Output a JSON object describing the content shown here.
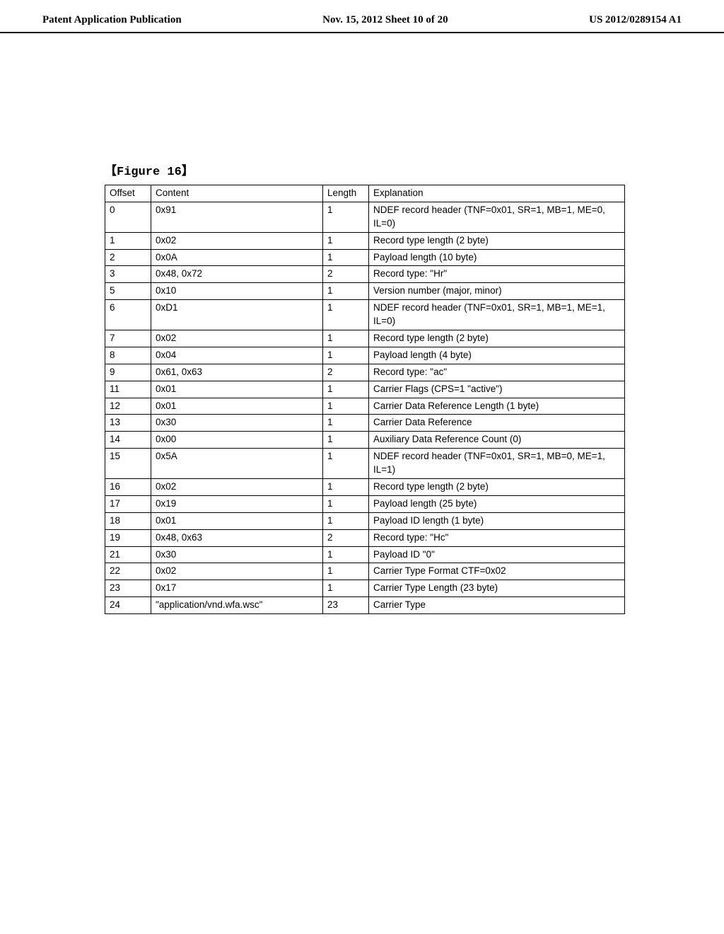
{
  "header": {
    "left": "Patent Application Publication",
    "center": "Nov. 15, 2012  Sheet 10 of 20",
    "right": "US 2012/0289154 A1"
  },
  "figure_title": "【Figure 16】",
  "columns": [
    "Offset",
    "Content",
    "Length",
    "Explanation"
  ],
  "rows": [
    {
      "offset": "0",
      "content": "0x91",
      "length": "1",
      "explanation": "NDEF record header (TNF=0x01, SR=1, MB=1, ME=0, IL=0)"
    },
    {
      "offset": "1",
      "content": "0x02",
      "length": "1",
      "explanation": "Record type length (2 byte)"
    },
    {
      "offset": "2",
      "content": "0x0A",
      "length": "1",
      "explanation": "Payload length (10 byte)"
    },
    {
      "offset": "3",
      "content": "0x48, 0x72",
      "length": "2",
      "explanation": "Record type: \"Hr\""
    },
    {
      "offset": "5",
      "content": "0x10",
      "length": "1",
      "explanation": "Version number (major, minor)"
    },
    {
      "offset": "6",
      "content": "0xD1",
      "length": "1",
      "explanation": "NDEF record header (TNF=0x01, SR=1, MB=1, ME=1, IL=0)"
    },
    {
      "offset": "7",
      "content": "0x02",
      "length": "1",
      "explanation": "Record type length (2 byte)"
    },
    {
      "offset": "8",
      "content": "0x04",
      "length": "1",
      "explanation": "Payload length (4 byte)"
    },
    {
      "offset": "9",
      "content": "0x61, 0x63",
      "length": "2",
      "explanation": "Record type: \"ac\""
    },
    {
      "offset": "11",
      "content": "0x01",
      "length": "1",
      "explanation": "Carrier Flags (CPS=1 \"active\")"
    },
    {
      "offset": "12",
      "content": "0x01",
      "length": "1",
      "explanation": "Carrier Data Reference Length (1 byte)"
    },
    {
      "offset": "13",
      "content": "0x30",
      "length": "1",
      "explanation": "Carrier Data Reference"
    },
    {
      "offset": "14",
      "content": "0x00",
      "length": "1",
      "explanation": "Auxiliary Data Reference Count (0)"
    },
    {
      "offset": "15",
      "content": "0x5A",
      "length": "1",
      "explanation": "NDEF record header (TNF=0x01, SR=1, MB=0, ME=1, IL=1)"
    },
    {
      "offset": "16",
      "content": "0x02",
      "length": "1",
      "explanation": "Record type length (2 byte)"
    },
    {
      "offset": "17",
      "content": "0x19",
      "length": "1",
      "explanation": "Payload length (25 byte)"
    },
    {
      "offset": "18",
      "content": "0x01",
      "length": "1",
      "explanation": "Payload ID length (1 byte)"
    },
    {
      "offset": "19",
      "content": "0x48, 0x63",
      "length": "2",
      "explanation": "Record type: \"Hc\""
    },
    {
      "offset": "21",
      "content": "0x30",
      "length": "1",
      "explanation": "Payload ID \"0\""
    },
    {
      "offset": "22",
      "content": "0x02",
      "length": "1",
      "explanation": "Carrier Type Format CTF=0x02"
    },
    {
      "offset": "23",
      "content": "0x17",
      "length": "1",
      "explanation": "Carrier Type Length (23 byte)"
    },
    {
      "offset": "24",
      "content": "\"application/vnd.wfa.wsc\"",
      "length": "23",
      "explanation": "Carrier Type"
    }
  ]
}
